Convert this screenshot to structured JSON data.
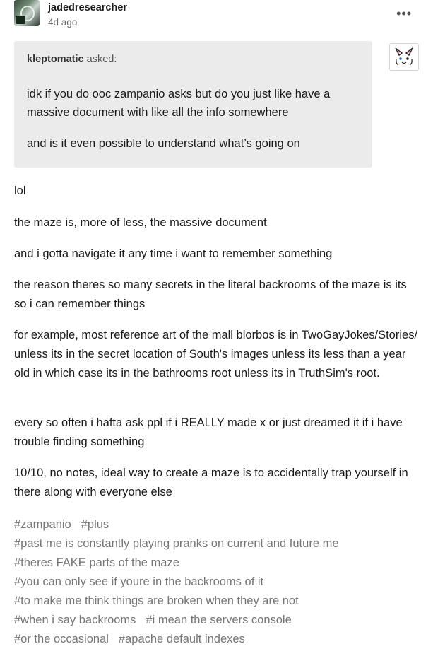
{
  "post": {
    "username": "jadedresearcher",
    "timestamp": "4d ago",
    "more_icon": "•••"
  },
  "ask": {
    "asker": "kleptomatic",
    "asked_label": "asked:",
    "paragraphs": [
      "idk if you do ooc zampanio asks but do you just like have a massive document with like all the info somewhere",
      "and is it even possible to understand what’s going on"
    ]
  },
  "answer": {
    "paragraphs": [
      "lol",
      "the maze is, more of less, the massive document",
      "and i gotta navigate it any time i want to remember something",
      "the reason theres so many secrets in the literal backrooms of the maze is its so i can remember things",
      "for example, most reference art of the mall blorbos is in TwoGayJokes/Stories/ unless its in the secret location of South's images unless its less than a year old in which case its in the bathrooms root unless its in TruthSim's root.",
      "every so often i hafta ask ppl if i REALLY made x or just dreamed it if i have trouble finding something",
      "10/10, no notes, ideal way to create a maze is to accidentally trap yourself in there along with everyone else"
    ]
  },
  "tags": {
    "lines": [
      [
        "#zampanio",
        "#plus"
      ],
      [
        "#past me is constantly playing pranks on current and future me"
      ],
      [
        "#theres FAKE parts of the maze"
      ],
      [
        "#you can only see if youre in the backrooms of it"
      ],
      [
        "#to make me think things are broken when they are not"
      ],
      [
        "#when i say backrooms",
        "#i mean the servers console"
      ],
      [
        "#or the occasional",
        "#apache default indexes"
      ]
    ]
  }
}
